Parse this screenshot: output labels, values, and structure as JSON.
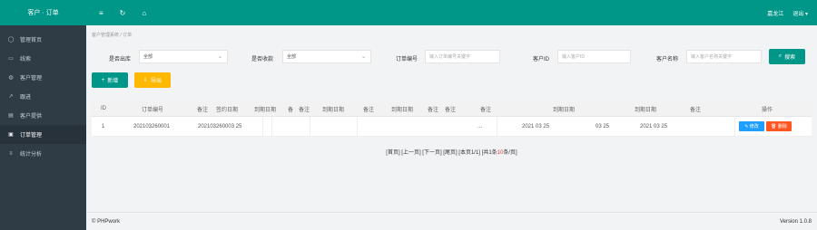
{
  "header": {
    "title": "客户 · 订单",
    "tools": [
      "≡",
      "↻",
      "⌂"
    ],
    "user": "嘉龙江",
    "exit": "退出 ▾"
  },
  "sidebar": {
    "items": [
      {
        "icon": "home-icon",
        "glyph": "◯",
        "label": "管理首页"
      },
      {
        "icon": "list-icon",
        "glyph": "▭",
        "label": "线索"
      },
      {
        "icon": "user-icon",
        "glyph": "◍",
        "label": "客户管理"
      },
      {
        "icon": "phone-icon",
        "glyph": "↗",
        "label": "跟进"
      },
      {
        "icon": "contract-icon",
        "glyph": "▤",
        "label": "客户提供"
      },
      {
        "icon": "order-icon",
        "glyph": "▣",
        "label": "订单管理"
      },
      {
        "icon": "chart-icon",
        "glyph": "≡",
        "label": "统计分析"
      }
    ]
  },
  "breadcrumb": "客户管理系统 / 订单",
  "filters": {
    "f1_label": "是否出库",
    "f1_value": "全部",
    "f2_label": "是否收款",
    "f2_value": "全部",
    "f3_label": "订单编号",
    "f3_placeholder": "输入订单编号关键字",
    "f4_label": "客户ID",
    "f4_placeholder": "输入客户ID",
    "f5_label": "客户名称",
    "f5_placeholder": "输入客户名称关键字",
    "search_label": "搜索"
  },
  "actions": {
    "add_label": "新增",
    "export_label": "导出"
  },
  "table": {
    "headers": [
      "ID",
      "订单编号",
      "备注",
      "签约日期",
      "到期日期",
      "备",
      "备注",
      "到期日期",
      "备注",
      "到期日期",
      "备注",
      "备注",
      "备注",
      "到期日期",
      "到期日期",
      "备注",
      "操作"
    ],
    "row": {
      "id": "1",
      "order_no": "202103260001",
      "sign_date": "202103260003 25",
      "mid": "...",
      "date1": "2021 03 25",
      "date2": "03 25",
      "date3": "2021 03 25",
      "edit_label": "✎ 修改",
      "delete_label": "🗑 删除"
    }
  },
  "pager": {
    "text_a": "[首页] [上一页] [下一页] [尾页] [本页1/1] [共",
    "count": "1",
    "text_b": "条",
    "per": "10",
    "text_c": "条/页]"
  },
  "footer": {
    "left": "© PHPwork",
    "right": "Version 1.0.8"
  }
}
